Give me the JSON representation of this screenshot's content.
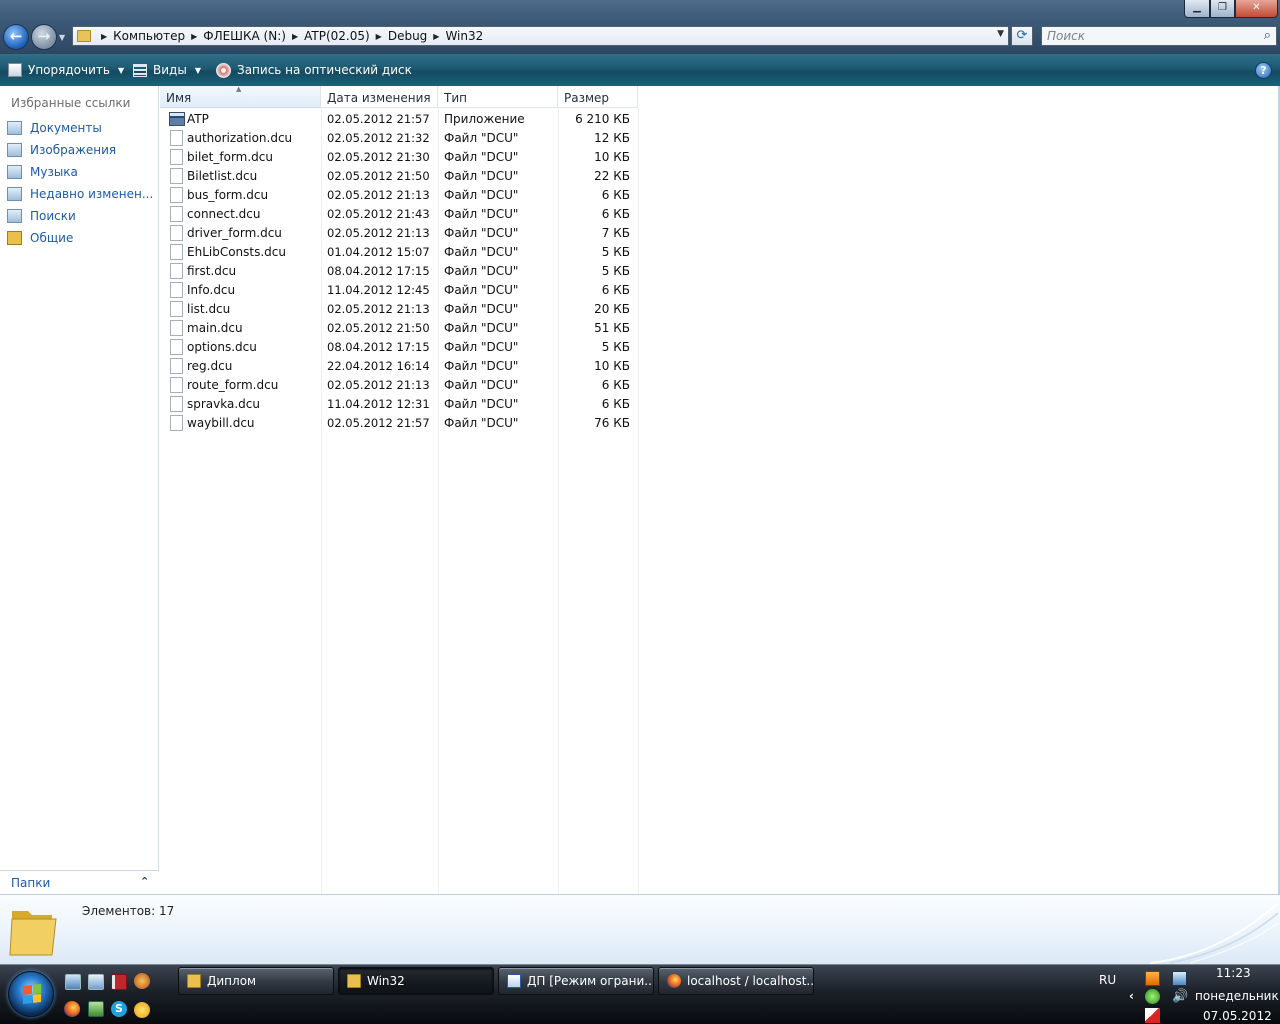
{
  "window": {
    "min_glyph": "▁",
    "max_glyph": "❐",
    "close_glyph": "✕"
  },
  "nav": {
    "back_glyph": "←",
    "forward_glyph": "→",
    "dropdown_glyph": "▼"
  },
  "address": {
    "crumbs": [
      "Компьютер",
      "ФЛЕШКА (N:)",
      "ATP(02.05)",
      "Debug",
      "Win32"
    ],
    "dropdown_glyph": "▼",
    "refresh_glyph": "⟳"
  },
  "search": {
    "placeholder": "Поиск",
    "icon_glyph": "⌕"
  },
  "commandbar": {
    "organize_label": "Упорядочить",
    "views_label": "Виды",
    "burn_label": "Запись на оптический диск",
    "arrow_glyph": "▼",
    "help_glyph": "?"
  },
  "sidebar": {
    "favorites_title": "Избранные ссылки",
    "items": [
      {
        "label": "Документы"
      },
      {
        "label": "Изображения"
      },
      {
        "label": "Музыка"
      },
      {
        "label": "Недавно изменен..."
      },
      {
        "label": "Поиски"
      },
      {
        "label": "Общие"
      }
    ],
    "folders_label": "Папки",
    "folders_glyph": "⌃"
  },
  "file_list": {
    "columns": {
      "name": "Имя",
      "date": "Дата изменения",
      "type": "Тип",
      "size": "Размер"
    },
    "sort_glyph": "▲",
    "rows": [
      {
        "name": "ATP",
        "date": "02.05.2012 21:57",
        "type": "Приложение",
        "size": "6 210 КБ",
        "icon": "app"
      },
      {
        "name": "authorization.dcu",
        "date": "02.05.2012 21:32",
        "type": "Файл \"DCU\"",
        "size": "12 КБ",
        "icon": "file"
      },
      {
        "name": "bilet_form.dcu",
        "date": "02.05.2012 21:30",
        "type": "Файл \"DCU\"",
        "size": "10 КБ",
        "icon": "file"
      },
      {
        "name": "Biletlist.dcu",
        "date": "02.05.2012 21:50",
        "type": "Файл \"DCU\"",
        "size": "22 КБ",
        "icon": "file"
      },
      {
        "name": "bus_form.dcu",
        "date": "02.05.2012 21:13",
        "type": "Файл \"DCU\"",
        "size": "6 КБ",
        "icon": "file"
      },
      {
        "name": "connect.dcu",
        "date": "02.05.2012 21:43",
        "type": "Файл \"DCU\"",
        "size": "6 КБ",
        "icon": "file"
      },
      {
        "name": "driver_form.dcu",
        "date": "02.05.2012 21:13",
        "type": "Файл \"DCU\"",
        "size": "7 КБ",
        "icon": "file"
      },
      {
        "name": "EhLibConsts.dcu",
        "date": "01.04.2012 15:07",
        "type": "Файл \"DCU\"",
        "size": "5 КБ",
        "icon": "file"
      },
      {
        "name": "first.dcu",
        "date": "08.04.2012 17:15",
        "type": "Файл \"DCU\"",
        "size": "5 КБ",
        "icon": "file"
      },
      {
        "name": "Info.dcu",
        "date": "11.04.2012 12:45",
        "type": "Файл \"DCU\"",
        "size": "6 КБ",
        "icon": "file"
      },
      {
        "name": "list.dcu",
        "date": "02.05.2012 21:13",
        "type": "Файл \"DCU\"",
        "size": "20 КБ",
        "icon": "file"
      },
      {
        "name": "main.dcu",
        "date": "02.05.2012 21:50",
        "type": "Файл \"DCU\"",
        "size": "51 КБ",
        "icon": "file"
      },
      {
        "name": "options.dcu",
        "date": "08.04.2012 17:15",
        "type": "Файл \"DCU\"",
        "size": "5 КБ",
        "icon": "file"
      },
      {
        "name": "reg.dcu",
        "date": "22.04.2012 16:14",
        "type": "Файл \"DCU\"",
        "size": "10 КБ",
        "icon": "file"
      },
      {
        "name": "route_form.dcu",
        "date": "02.05.2012 21:13",
        "type": "Файл \"DCU\"",
        "size": "6 КБ",
        "icon": "file"
      },
      {
        "name": "spravka.dcu",
        "date": "11.04.2012 12:31",
        "type": "Файл \"DCU\"",
        "size": "6 КБ",
        "icon": "file"
      },
      {
        "name": "waybill.dcu",
        "date": "02.05.2012 21:57",
        "type": "Файл \"DCU\"",
        "size": "76 КБ",
        "icon": "file"
      }
    ]
  },
  "details": {
    "items_count": "Элементов: 17"
  },
  "taskbar": {
    "tasks": [
      {
        "label": "Диплом",
        "icon": "folder",
        "active": false
      },
      {
        "label": "Win32",
        "icon": "folder",
        "active": true
      },
      {
        "label": "ДП [Режим ограни...",
        "icon": "word",
        "active": false
      },
      {
        "label": "localhost / localhost...",
        "icon": "firefox",
        "active": false
      }
    ],
    "skype_glyph": "S"
  },
  "tray": {
    "language": "RU",
    "chevron_glyph": "‹",
    "volume_glyph": "🔊",
    "time": "11:23",
    "day": "понедельник",
    "date": "07.05.2012"
  },
  "colors": {
    "link_blue": "#1e5aa5",
    "commandbar_teal": "#1e5a73",
    "selected_column": "#e0edf9"
  }
}
